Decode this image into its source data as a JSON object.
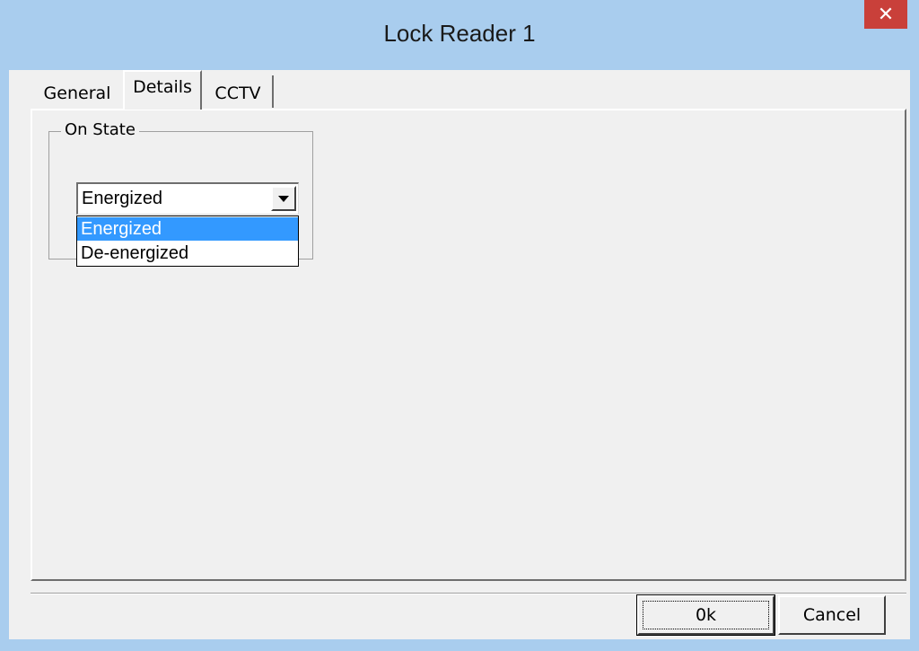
{
  "window": {
    "title": "Lock Reader 1",
    "close_label": "✕"
  },
  "tabs": [
    {
      "label": "General",
      "active": false
    },
    {
      "label": "Details",
      "active": true
    },
    {
      "label": "CCTV",
      "active": false
    }
  ],
  "on_state": {
    "group_label": "On State",
    "selected_value": "Energized",
    "options": [
      "Energized",
      "De-energized"
    ],
    "highlighted_option": "Energized"
  },
  "buttons": {
    "ok_label": "0k",
    "cancel_label": "Cancel"
  },
  "colors": {
    "title_bar": "#a9cdee",
    "close_button": "#c9403a",
    "selection": "#3399ff",
    "dialog_background": "#f0f0f0"
  }
}
